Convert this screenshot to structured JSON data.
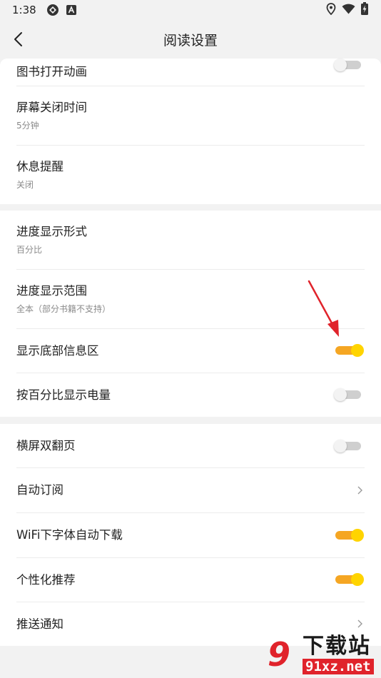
{
  "status_bar": {
    "time": "1:38",
    "left_icons": [
      "vpn-icon",
      "font-a-icon"
    ],
    "right_icons": [
      "location-icon",
      "wifi-icon",
      "battery-charging-icon"
    ]
  },
  "header": {
    "title": "阅读设置"
  },
  "colors": {
    "accent": "#f5a623",
    "knob_on": "#ffd400",
    "annotation_arrow": "#e0232b"
  },
  "groups": [
    {
      "items": [
        {
          "title": "图书打开动画",
          "control": "toggle",
          "on": false
        },
        {
          "title": "屏幕关闭时间",
          "subtitle": "5分钟"
        },
        {
          "title": "休息提醒",
          "subtitle": "关闭"
        }
      ]
    },
    {
      "items": [
        {
          "title": "进度显示形式",
          "subtitle": "百分比"
        },
        {
          "title": "进度显示范围",
          "subtitle": "全本（部分书籍不支持）"
        },
        {
          "title": "显示底部信息区",
          "control": "toggle",
          "on": true
        },
        {
          "title": "按百分比显示电量",
          "control": "toggle",
          "on": false
        }
      ]
    },
    {
      "items": [
        {
          "title": "横屏双翻页",
          "control": "toggle",
          "on": false
        },
        {
          "title": "自动订阅",
          "control": "chevron"
        },
        {
          "title": "WiFi下字体自动下载",
          "control": "toggle",
          "on": true
        },
        {
          "title": "个性化推荐",
          "control": "toggle",
          "on": true
        },
        {
          "title": "推送通知",
          "control": "chevron"
        }
      ]
    }
  ],
  "watermark": {
    "mark": "9",
    "cn": "下载站",
    "url": "91xz.net"
  }
}
